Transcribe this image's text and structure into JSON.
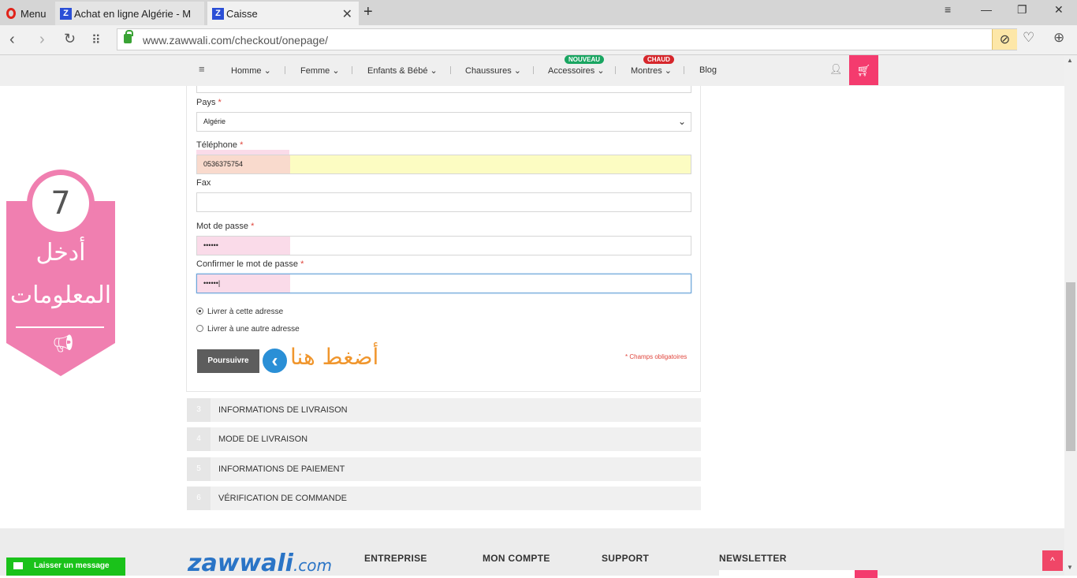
{
  "browser": {
    "menu_label": "Menu",
    "tabs": [
      {
        "title": "Achat en ligne Algérie - M"
      },
      {
        "title": "Caisse"
      }
    ],
    "url": "www.zawwali.com/checkout/onepage/"
  },
  "nav": {
    "items": [
      "Homme",
      "Femme",
      "Enfants & Bébé",
      "Chaussures",
      "Accessoires",
      "Montres",
      "Blog"
    ],
    "badges": {
      "accessoires": "NOUVEAU",
      "montres": "CHAUD"
    }
  },
  "form": {
    "country_label": "Pays",
    "country_value": "Algérie",
    "phone_label": "Téléphone",
    "phone_value": "0536375754",
    "fax_label": "Fax",
    "password_label": "Mot de passe",
    "password_value": "••••••",
    "confirm_label": "Confirmer le mot de passe",
    "confirm_value": "••••••",
    "required_mark": "*",
    "ship_same": "Livrer à cette adresse",
    "ship_other": "Livrer à une autre adresse",
    "continue_button": "Poursuivre",
    "required_note": "* Champs obligatoires"
  },
  "annotation": {
    "step_number": "7",
    "instruction_line1": "أدخل",
    "instruction_line2": "المعلومات",
    "click_here": "أضغط هنا"
  },
  "steps": [
    {
      "num": "3",
      "title": "INFORMATIONS DE LIVRAISON"
    },
    {
      "num": "4",
      "title": "MODE DE LIVRAISON"
    },
    {
      "num": "5",
      "title": "INFORMATIONS DE PAIEMENT"
    },
    {
      "num": "6",
      "title": "VÉRIFICATION DE COMMANDE"
    }
  ],
  "footer": {
    "logo_main": "zawwali",
    "logo_suffix": ".com",
    "headings": [
      "ENTREPRISE",
      "MON COMPTE",
      "SUPPORT",
      "NEWSLETTER"
    ],
    "chat_label": "Laisser un message",
    "totop_label": "^"
  },
  "colors": {
    "accent": "#f43b6e",
    "callout": "#f07fb0",
    "link_blue": "#2a74c6",
    "orange_text": "#f0962d"
  }
}
